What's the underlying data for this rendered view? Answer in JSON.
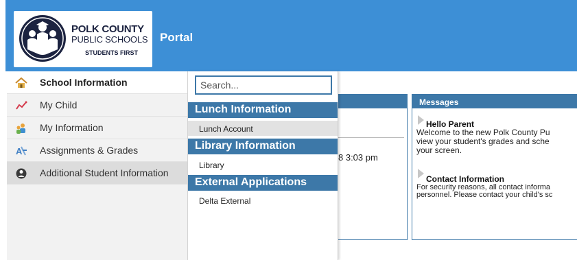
{
  "header": {
    "logo": {
      "line1": "POLK COUNTY",
      "line2": "PUBLIC SCHOOLS",
      "line3": "STUDENTS FIRST"
    },
    "title": "Portal"
  },
  "sidebar": {
    "items": [
      {
        "label": "School Information",
        "icon": "home-icon"
      },
      {
        "label": "My Child",
        "icon": "chart-icon"
      },
      {
        "label": "My Information",
        "icon": "people-icon"
      },
      {
        "label": "Assignments & Grades",
        "icon": "assignments-icon"
      },
      {
        "label": "Additional Student Information",
        "icon": "globe-icon"
      }
    ]
  },
  "dropdown": {
    "search_placeholder": "Search...",
    "sections": [
      {
        "header": "Lunch Information",
        "items": [
          "Lunch Account"
        ]
      },
      {
        "header": "Library Information",
        "items": [
          "Library"
        ]
      },
      {
        "header": "External Applications",
        "items": [
          "Delta External"
        ]
      }
    ]
  },
  "main": {
    "timestamp_fragment": "8 3:03 pm"
  },
  "messages": {
    "header": "Messages",
    "items": [
      {
        "title": "Hello Parent",
        "body": [
          "Welcome to the new Polk County Pu",
          "view your student's grades and sche",
          "your screen."
        ]
      },
      {
        "title": "Contact Information",
        "body": [
          "For security reasons, all contact informa",
          "personnel. Please contact your child's sc"
        ]
      }
    ]
  },
  "colors": {
    "header_bg": "#3d8fd6",
    "section_bg": "#3d78a8",
    "sidebar_bg": "#f2f2f2"
  }
}
